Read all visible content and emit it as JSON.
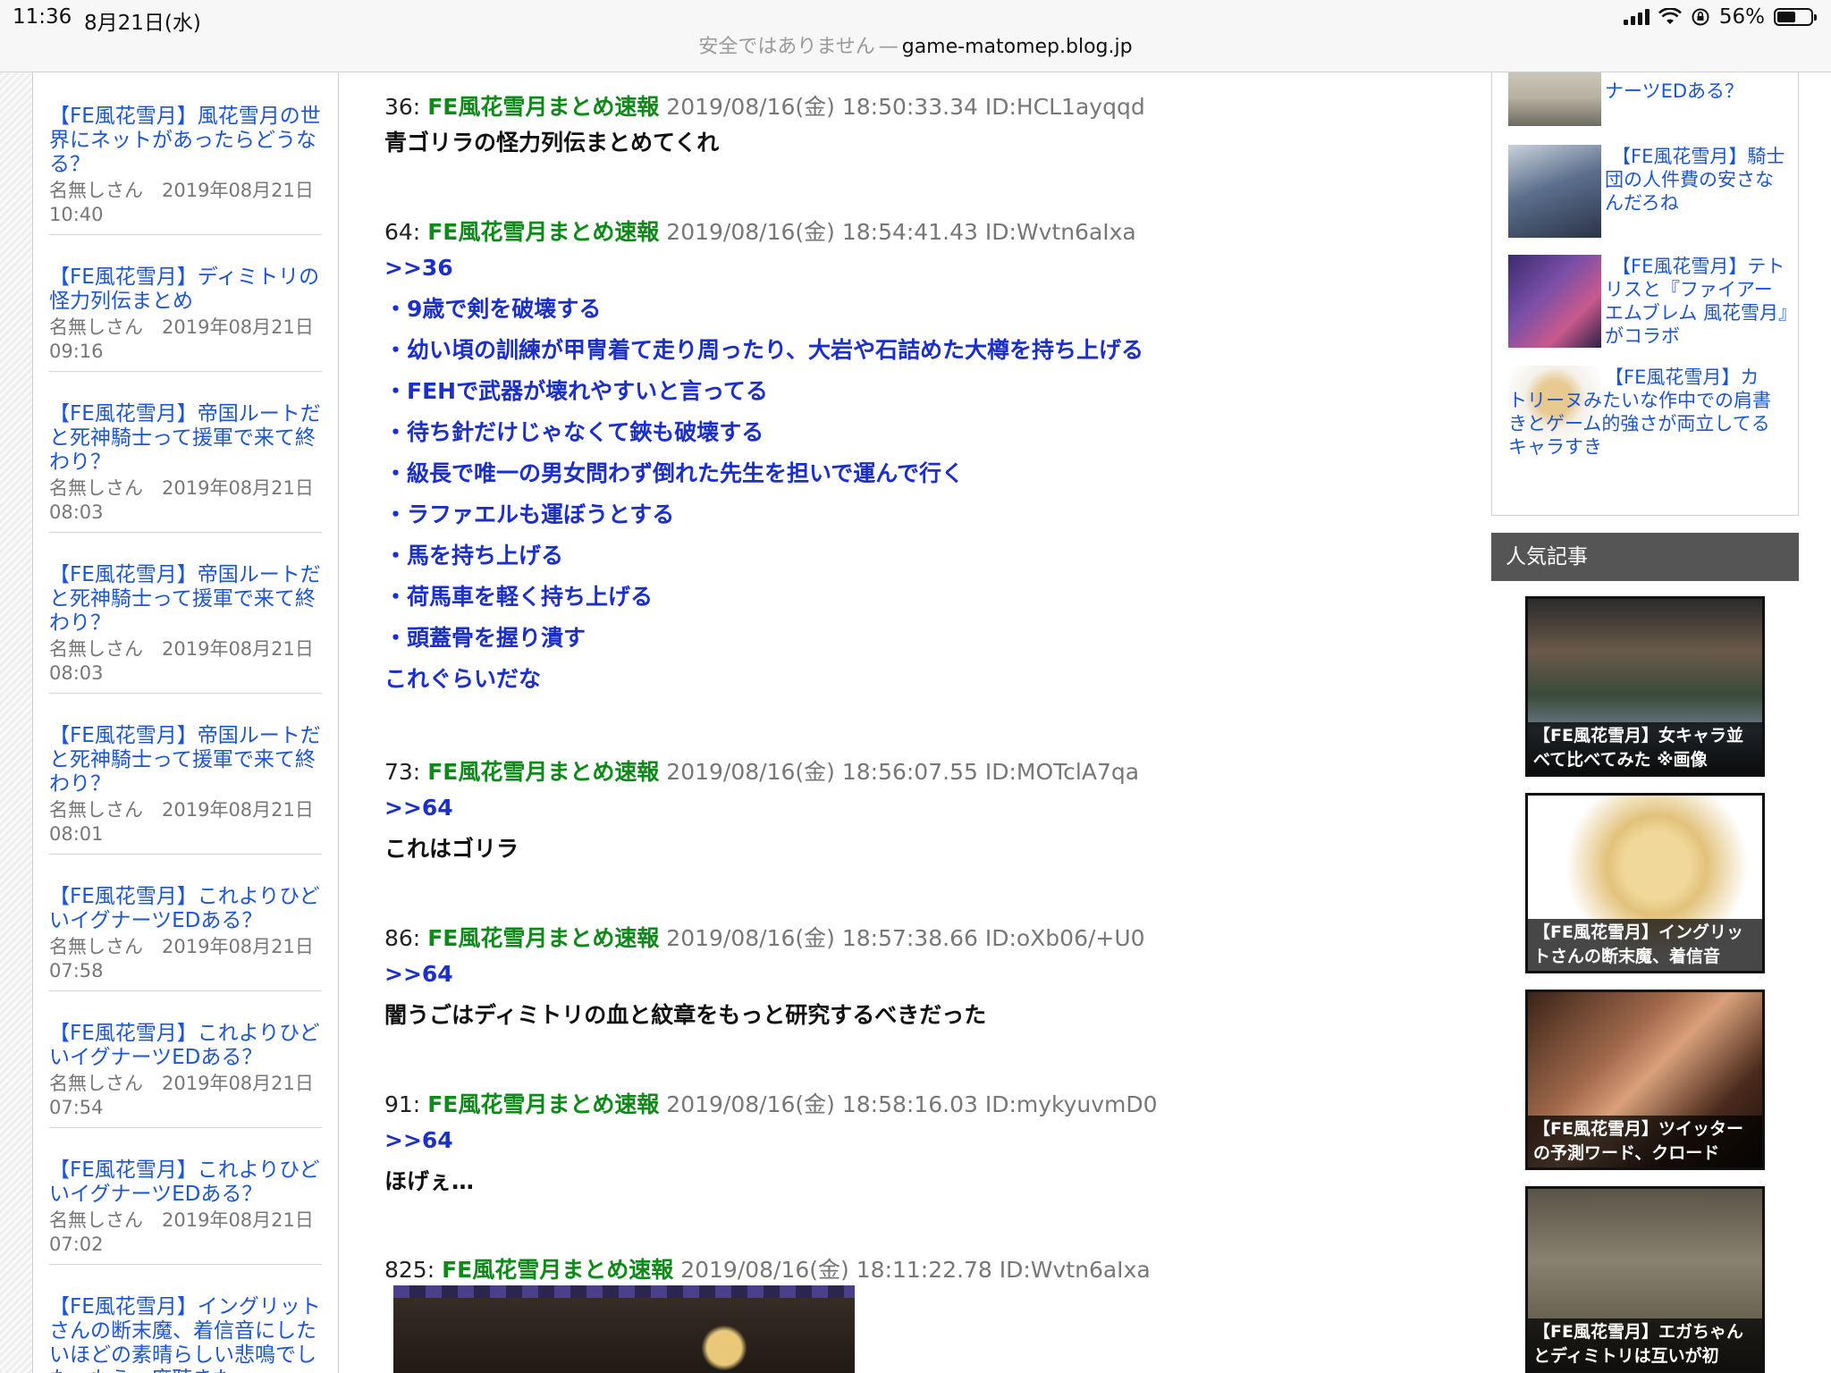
{
  "status": {
    "time": "11:36",
    "date": "8月21日(水)",
    "battery": "56%",
    "battery_level": 0.56
  },
  "url_bar": {
    "insecure_label": "安全ではありません",
    "separator": "—",
    "domain": "game-matomep.blog.jp"
  },
  "left_sidebar": {
    "items": [
      {
        "title": "【FE風花雪月】風花雪月の世界にネットがあったらどうなる？",
        "meta": "名無しさん　2019年08月21日 10:40"
      },
      {
        "title": "【FE風花雪月】ディミトリの怪力列伝まとめ",
        "meta": "名無しさん　2019年08月21日 09:16"
      },
      {
        "title": "【FE風花雪月】帝国ルートだと死神騎士って援軍で来て終わり？",
        "meta": "名無しさん　2019年08月21日 08:03"
      },
      {
        "title": "【FE風花雪月】帝国ルートだと死神騎士って援軍で来て終わり？",
        "meta": "名無しさん　2019年08月21日 08:03"
      },
      {
        "title": "【FE風花雪月】帝国ルートだと死神騎士って援軍で来て終わり？",
        "meta": "名無しさん　2019年08月21日 08:01"
      },
      {
        "title": "【FE風花雪月】これよりひどいイグナーツEDある？",
        "meta": "名無しさん　2019年08月21日 07:58"
      },
      {
        "title": "【FE風花雪月】これよりひどいイグナーツEDある？",
        "meta": "名無しさん　2019年08月21日 07:54"
      },
      {
        "title": "【FE風花雪月】これよりひどいイグナーツEDある？",
        "meta": "名無しさん　2019年08月21日 07:02"
      },
      {
        "title": "【FE風花雪月】イングリットさんの断末魔、着信音にしたいほどの素晴らしい悲鳴でした。もう一度聴きた",
        "meta": ""
      }
    ]
  },
  "posts": [
    {
      "num": "36:",
      "name": "FE風花雪月まとめ速報",
      "meta": "2019/08/16(金) 18:50:33.34 ID:HCL1ayqqd",
      "anchor": "",
      "color": "black",
      "lines": [
        "青ゴリラの怪力列伝まとめてくれ"
      ]
    },
    {
      "num": "64:",
      "name": "FE風花雪月まとめ速報",
      "meta": "2019/08/16(金) 18:54:41.43 ID:Wvtn6aIxa",
      "anchor": ">>36",
      "color": "blue",
      "lines": [
        "・9歳で剣を破壊する",
        "・幼い頃の訓練が甲冑着て走り周ったり、大岩や石詰めた大樽を持ち上げる",
        "・FEHで武器が壊れやすいと言ってる",
        "・待ち針だけじゃなくて鋏も破壊する",
        "・級長で唯一の男女問わず倒れた先生を担いで運んで行く",
        "・ラファエルも運ぼうとする",
        "・馬を持ち上げる",
        "・荷馬車を軽く持ち上げる",
        "・頭蓋骨を握り潰す",
        "これぐらいだな"
      ]
    },
    {
      "num": "73:",
      "name": "FE風花雪月まとめ速報",
      "meta": "2019/08/16(金) 18:56:07.55 ID:MOTclA7qa",
      "anchor": ">>64",
      "color": "black",
      "lines": [
        "これはゴリラ"
      ]
    },
    {
      "num": "86:",
      "name": "FE風花雪月まとめ速報",
      "meta": "2019/08/16(金) 18:57:38.66 ID:oXb06/+U0",
      "anchor": ">>64",
      "color": "black",
      "lines": [
        "闇うごはディミトリの血と紋章をもっと研究するべきだった"
      ]
    },
    {
      "num": "91:",
      "name": "FE風花雪月まとめ速報",
      "meta": "2019/08/16(金) 18:58:16.03 ID:mykyuvmD0",
      "anchor": ">>64",
      "color": "black",
      "lines": [
        "ほげぇ…"
      ]
    },
    {
      "num": "825:",
      "name": "FE風花雪月まとめ速報",
      "meta": "2019/08/16(金) 18:11:22.78 ID:Wvtn6aIxa",
      "anchor": "",
      "color": "black",
      "lines": []
    }
  ],
  "right_sidebar": {
    "recent": [
      {
        "title": "ナーツEDある？"
      },
      {
        "title": "【FE風花雪月】騎士団の人件費の安さなんだろね"
      },
      {
        "title": "【FE風花雪月】テトリスと『ファイアーエムブレム 風花雪月』がコラボ"
      },
      {
        "title": "【FE風花雪月】カトリーヌみたいな作中での肩書きとゲーム的強さが両立してるキャラすき"
      }
    ],
    "popular_header": "人気記事",
    "popular": [
      {
        "caption": "【FE風花雪月】女キャラ並べて比べてみた ※画像"
      },
      {
        "caption": "【FE風花雪月】イングリットさんの断末魔、着信音"
      },
      {
        "caption": "【FE風花雪月】ツイッターの予測ワード、クロード"
      },
      {
        "caption": "【FE風花雪月】エガちゃんとディミトリは互いが初"
      }
    ]
  },
  "colors": {
    "link_blue": "#1a56d6",
    "anchor_blue": "#1a2fcc",
    "name_green": "#0d8a18",
    "meta_gray": "#777777"
  }
}
